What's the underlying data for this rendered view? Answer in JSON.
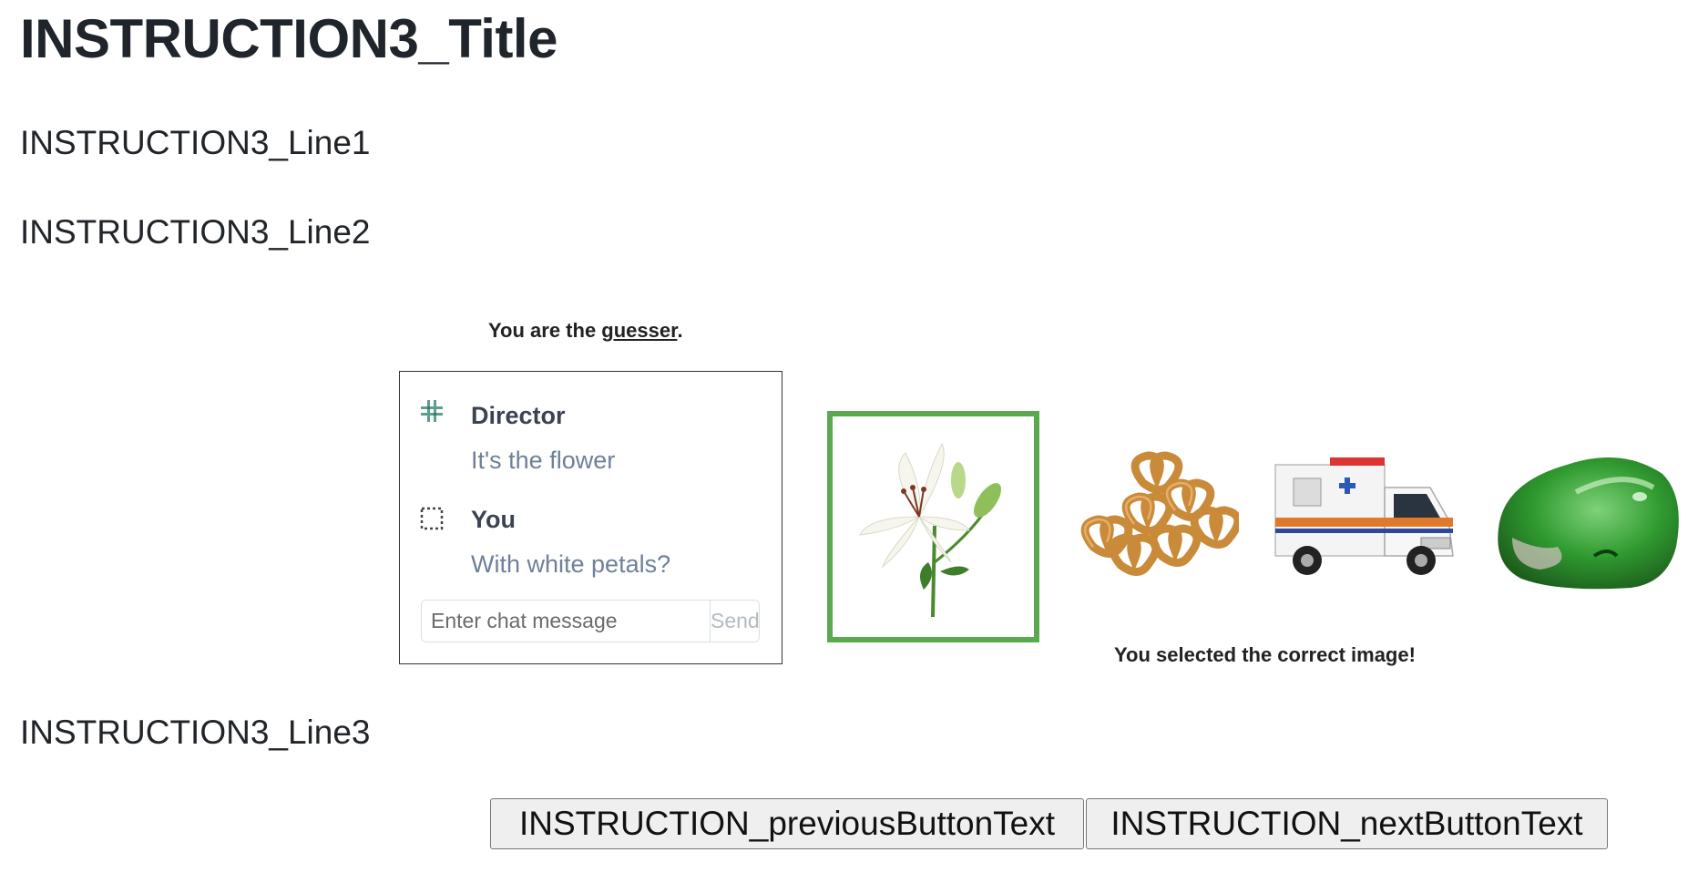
{
  "instruction": {
    "title": "INSTRUCTION3_Title",
    "line1": "INSTRUCTION3_Line1",
    "line2": "INSTRUCTION3_Line2",
    "line3": "INSTRUCTION3_Line3"
  },
  "illustration": {
    "role_prefix": "You are the ",
    "role_word": "guesser",
    "role_suffix": ".",
    "chat": {
      "messages": [
        {
          "sender": "Director",
          "text": "It's the flower",
          "icon": "director-avatar-icon"
        },
        {
          "sender": "You",
          "text": "With white petals?",
          "icon": "you-avatar-icon"
        }
      ],
      "input_placeholder": "Enter chat message",
      "send_label": "Send"
    },
    "images": [
      {
        "name": "lily-flower",
        "selected": true
      },
      {
        "name": "pretzels",
        "selected": false
      },
      {
        "name": "ambulance",
        "selected": false
      },
      {
        "name": "green-soap",
        "selected": false
      }
    ],
    "result": "You selected the correct image!",
    "selected_border_color": "#5aa94f"
  },
  "buttons": {
    "previous": "INSTRUCTION_previousButtonText",
    "next": "INSTRUCTION_nextButtonText"
  }
}
